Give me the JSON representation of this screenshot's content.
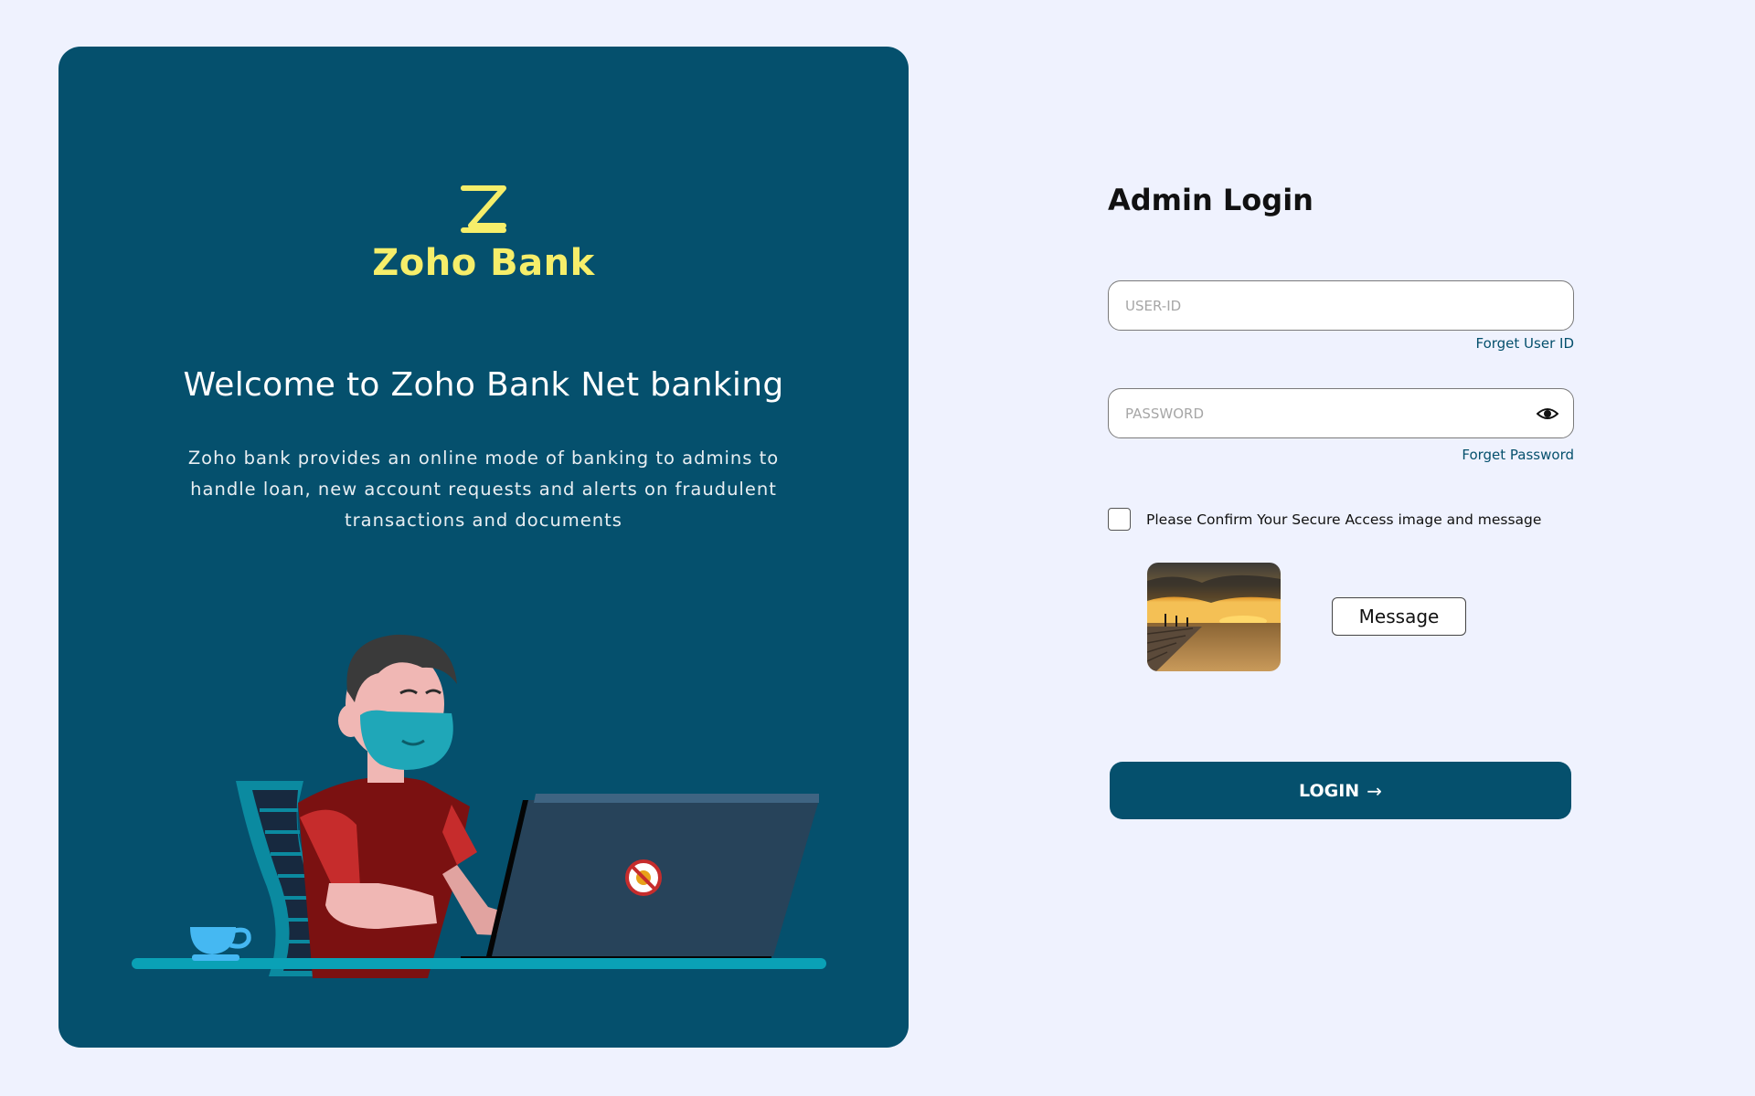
{
  "brand": {
    "name": "Zoho Bank",
    "logo_icon": "zoho-z-logo-icon",
    "accent_color": "#f6ee6a",
    "panel_color": "#05506d"
  },
  "hero": {
    "welcome": "Welcome to Zoho Bank Net banking",
    "description": "Zoho bank provides an online mode of banking to admins to handle loan, new account requests and alerts on fraudulent transactions and documents"
  },
  "form": {
    "title": "Admin Login",
    "userid": {
      "placeholder": "USER-ID",
      "value": ""
    },
    "forget_userid": "Forget User ID",
    "password": {
      "placeholder": "PASSWORD",
      "value": "",
      "toggle_icon": "eye-icon"
    },
    "forget_password": "Forget Password",
    "confirm_label": "Please Confirm Your Secure Access image and message",
    "confirm_checked": false,
    "secure_message": "Message",
    "login_label": "LOGIN",
    "login_arrow": "→"
  }
}
